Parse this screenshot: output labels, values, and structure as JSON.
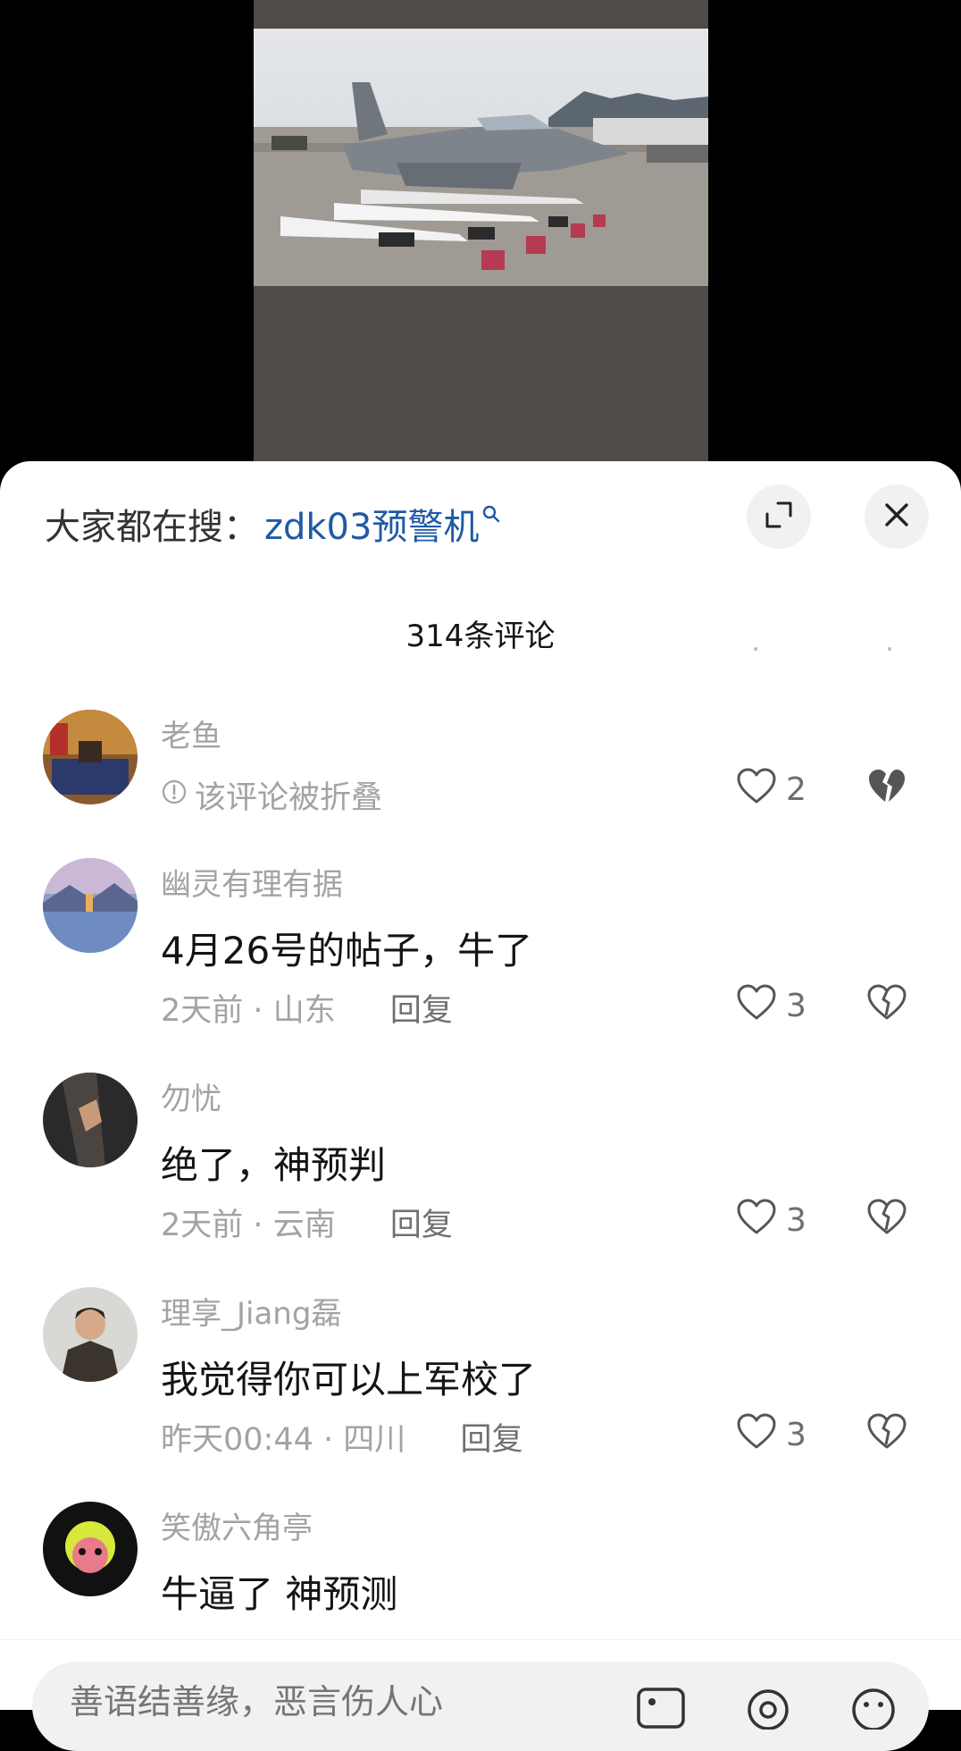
{
  "search": {
    "prefix": "大家都在搜：",
    "term": "zdk03预警机"
  },
  "comments_header": {
    "count_label": "314条评论"
  },
  "comments": [
    {
      "username": "老鱼",
      "folded_text": "该评论被折叠",
      "likes": "2"
    },
    {
      "username": "幽灵有理有据",
      "text": "4月26号的帖子，牛了",
      "time": "2天前",
      "location": "山东",
      "reply": "回复",
      "likes": "3"
    },
    {
      "username": "勿忧",
      "text": "绝了，神预判",
      "time": "2天前",
      "location": "云南",
      "reply": "回复",
      "likes": "3"
    },
    {
      "username": "理享_Jiang磊",
      "text": "我觉得你可以上军校了",
      "time": "昨天00:44",
      "location": "四川",
      "reply": "回复",
      "likes": "3"
    },
    {
      "username": "笑傲六角亭",
      "text": "牛逼了 神预测"
    }
  ],
  "input": {
    "placeholder": "善语结善缘，恶言伤人心"
  },
  "colors": {
    "accent_link": "#1f5aa6",
    "muted_text": "#a3a3a3",
    "sheet_bg": "#ffffff"
  },
  "icons": [
    "search-icon",
    "expand-icon",
    "close-icon",
    "heart-icon",
    "broken-heart-icon",
    "image-icon",
    "at-icon",
    "emoji-icon",
    "warning-icon"
  ]
}
